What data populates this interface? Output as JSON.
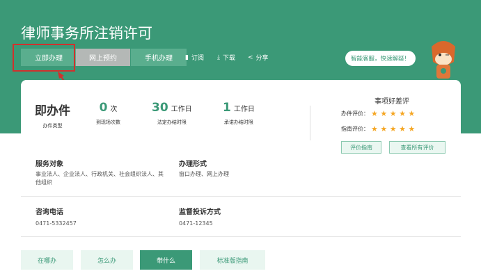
{
  "title": "律师事务所注销许可",
  "buttons": {
    "apply": "立即办理",
    "reserve": "网上预约",
    "mobile": "手机办理"
  },
  "actions": {
    "subscribe": "订阅",
    "download": "下载",
    "share": "分享"
  },
  "assistant": "智能客服，快速解疑！",
  "stats": [
    {
      "value": "即办件",
      "unit": "",
      "label": "办件类型"
    },
    {
      "value": "0",
      "unit": "次",
      "label": "到现场次数"
    },
    {
      "value": "30",
      "unit": "工作日",
      "label": "法定办结时限"
    },
    {
      "value": "1",
      "unit": "工作日",
      "label": "承诺办结时限"
    }
  ],
  "review": {
    "title": "事项好差评",
    "handle_label": "办件评价：",
    "guide_label": "指南评价：",
    "handle_stars": 5,
    "guide_stars": 5,
    "rate_btn": "评价指南",
    "all_btn": "查看所有评价"
  },
  "info": {
    "target_label": "服务对象",
    "target_value": "事业法人、企业法人、行政机关、社会组织法人、其他组织",
    "form_label": "办理形式",
    "form_value": "窗口办理、网上办理",
    "phone_label": "咨询电话",
    "phone_value": "0471-5332457",
    "complaint_label": "监督投诉方式",
    "complaint_value": "0471-12345"
  },
  "tabs": [
    "在哪办",
    "怎么办",
    "带什么",
    "标准版指南"
  ],
  "active_tab": 2,
  "colors": {
    "brand": "#3b9977",
    "highlight": "#d0312d",
    "star": "#f5a623"
  }
}
